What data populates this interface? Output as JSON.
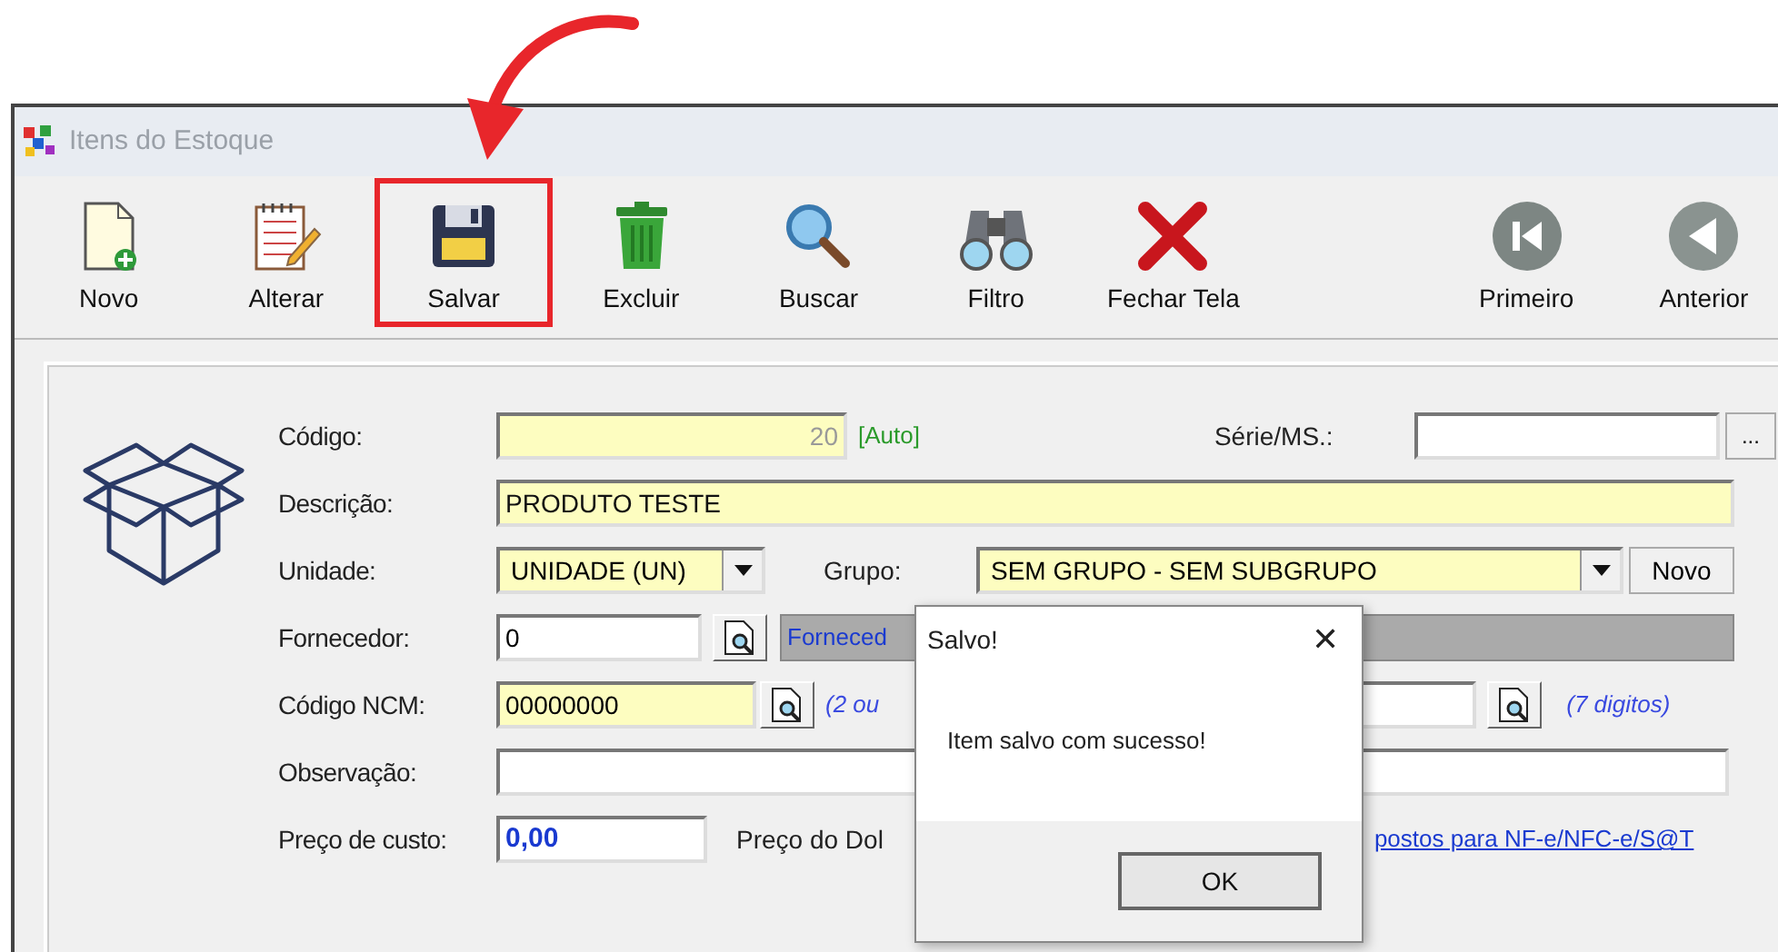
{
  "window": {
    "title": "Itens do Estoque"
  },
  "toolbar": [
    {
      "label": "Novo",
      "kind": "new",
      "highlighted": false
    },
    {
      "label": "Alterar",
      "kind": "edit",
      "highlighted": false
    },
    {
      "label": "Salvar",
      "kind": "save",
      "highlighted": true
    },
    {
      "label": "Excluir",
      "kind": "delete",
      "highlighted": false
    },
    {
      "label": "Buscar",
      "kind": "search",
      "highlighted": false
    },
    {
      "label": "Filtro",
      "kind": "filter",
      "highlighted": false
    },
    {
      "label": "Fechar Tela",
      "kind": "close",
      "highlighted": false
    }
  ],
  "navigation": [
    {
      "label": "Primeiro",
      "kind": "first"
    },
    {
      "label": "Anterior",
      "kind": "previous"
    }
  ],
  "form": {
    "codigo": {
      "label": "Código:",
      "value": "20",
      "hint": "[Auto]"
    },
    "serie": {
      "label": "Série/MS.:",
      "button": "..."
    },
    "descricao": {
      "label": "Descrição:",
      "value": "PRODUTO TESTE"
    },
    "unidade": {
      "label": "Unidade:",
      "value": "UNIDADE (UN)"
    },
    "grupo": {
      "label": "Grupo:",
      "value": "SEM GRUPO - SEM SUBGRUPO",
      "button": "Novo"
    },
    "fornecedor": {
      "label": "Fornecedor:",
      "value": "0",
      "name": "Forneced"
    },
    "ncm": {
      "label": "Código NCM:",
      "value": "00000000",
      "hint": "(2 ou",
      "hint_2": "(7 digitos)"
    },
    "observacao": {
      "label": "Observação:"
    },
    "preco_custo": {
      "label": "Preço de custo:",
      "value": "0,00"
    },
    "preco_dolar": {
      "label": "Preço do Dol"
    },
    "link": "postos para NF-e/NFC-e/S@T"
  },
  "dialog": {
    "title": "Salvo!",
    "close": "✕",
    "message": "Item salvo com sucesso!",
    "button": "OK"
  }
}
